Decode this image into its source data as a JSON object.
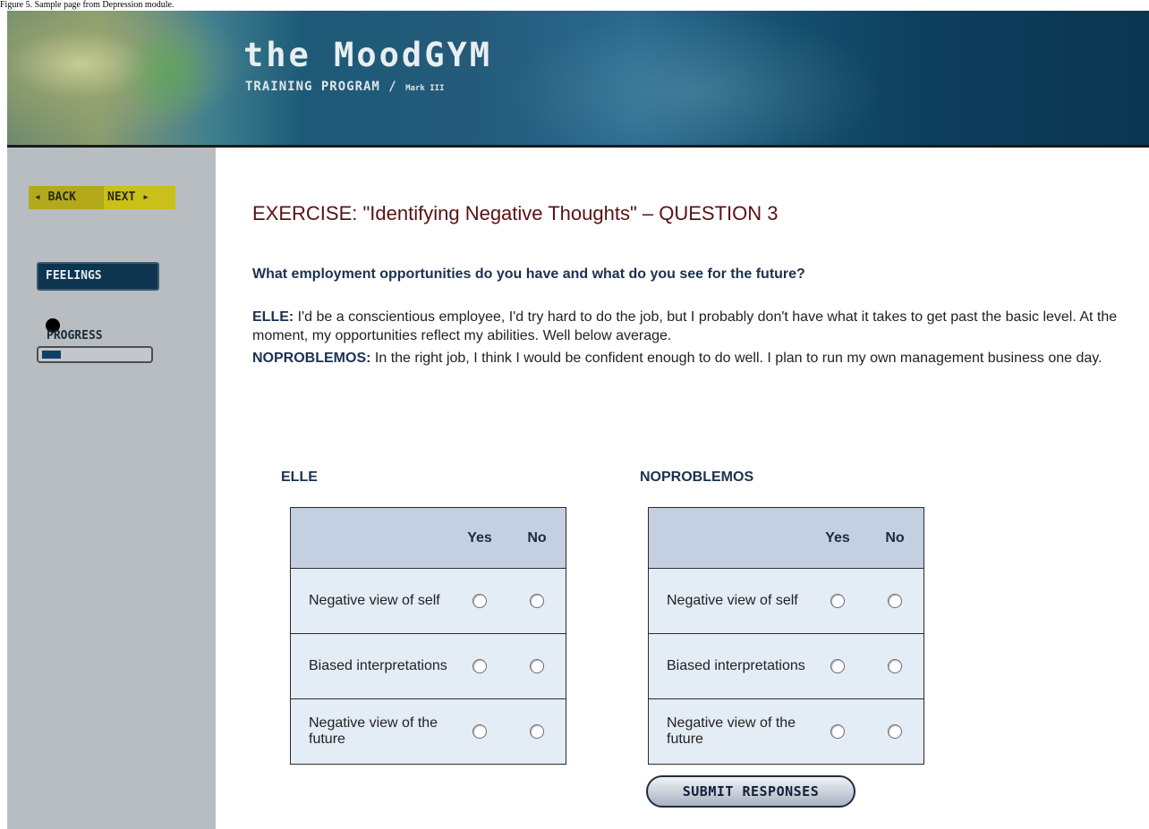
{
  "figure_title": "Figure 5. Sample page from Depression module.",
  "header": {
    "brand_title": "the MoodGYM",
    "brand_subtitle": "TRAINING PROGRAM / ",
    "brand_version": "Mark III"
  },
  "sidebar": {
    "back_label": "◂ BACK",
    "next_label": "NEXT ▸",
    "module_label": "FEELINGS",
    "progress_label": "PROGRESS",
    "progress_value": 0.18
  },
  "main": {
    "title": "EXERCISE: \"Identifying Negative Thoughts\" – QUESTION 3",
    "question": "What employment opportunities do you have and what do you see for the future?",
    "responses": [
      {
        "speaker": "ELLE:",
        "text": " I'd be a conscientious employee, I'd try hard to do the job, but I probably don't have what it takes to get past the basic level. At the moment, my opportunities reflect my abilities. Well below average."
      },
      {
        "speaker": "NOPROBLEMOS:",
        "text": " In the right job, I think I would be confident enough to do well. I plan to run my own management business one day."
      }
    ]
  },
  "tables": [
    {
      "label": "ELLE",
      "col_yes": "Yes",
      "col_no": "No",
      "rows": [
        "Negative view of self",
        "Biased interpretations",
        "Negative view of the future"
      ]
    },
    {
      "label": "NOPROBLEMOS",
      "col_yes": "Yes",
      "col_no": "No",
      "rows": [
        "Negative view of self",
        "Biased interpretations",
        "Negative view of the future"
      ]
    }
  ],
  "submit_label": "SUBMIT RESPONSES"
}
